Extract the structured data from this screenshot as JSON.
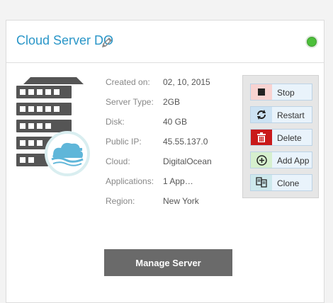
{
  "header": {
    "title": "Cloud Server DO",
    "status_color": "#4cbf3a"
  },
  "details": [
    {
      "label": "Created on:",
      "value": "02, 10, 2015"
    },
    {
      "label": "Server Type:",
      "value": "2GB"
    },
    {
      "label": "Disk:",
      "value": "40 GB"
    },
    {
      "label": "Public IP:",
      "value": "45.55.137.0"
    },
    {
      "label": "Cloud:",
      "value": "DigitalOcean"
    },
    {
      "label": "Applications:",
      "value": "1 App…"
    },
    {
      "label": "Region:",
      "value": "New York"
    }
  ],
  "actions": {
    "stop": "Stop",
    "restart": "Restart",
    "delete": "Delete",
    "add_app": "Add App",
    "clone": "Clone"
  },
  "manage_label": "Manage Server",
  "icons": {
    "edit": "pencil-icon",
    "server": "server-rack-icon",
    "cloud_badge": "digitalocean-cloud-icon",
    "stop": "stop-square-icon",
    "restart": "refresh-icon",
    "delete": "trash-icon",
    "add_app": "plus-circle-icon",
    "clone": "clone-icon"
  }
}
